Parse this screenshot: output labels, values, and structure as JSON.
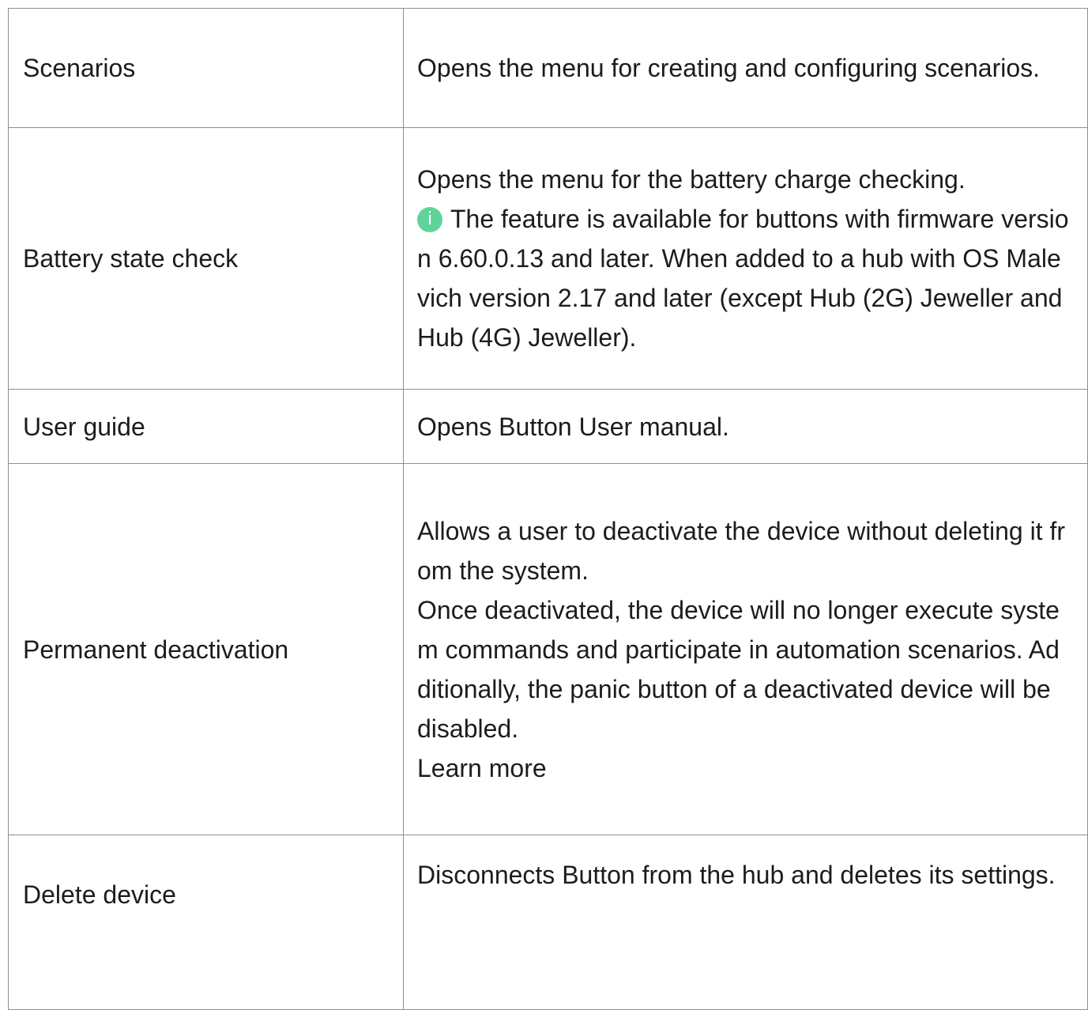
{
  "rows": [
    {
      "name": "Scenarios",
      "desc": [
        "Opens the menu for creating and configuring scenarios."
      ]
    },
    {
      "name": "Battery state check",
      "desc": [
        "Opens the menu for the battery charge checking.",
        "The feature is available for buttons with firmware version 6.60.0.13 and later. When added to a hub with OS Malevich version 2.17 and later (except Hub (2G) Jeweller and Hub (4G) Jeweller)."
      ],
      "info_icon_glyph": "i",
      "info_icon": "info-circle-icon",
      "info_icon_color": "#5fd49a"
    },
    {
      "name": "User guide",
      "desc": [
        "Opens Button User manual."
      ]
    },
    {
      "name": "Permanent deactivation",
      "desc": [
        "Allows a user to deactivate the device without deleting it from the system.",
        "Once deactivated, the device will no longer execute system commands and participate in automation scenarios. Additionally, the panic button of a deactivated device will be disabled.",
        "Learn more"
      ]
    },
    {
      "name": "Delete device",
      "desc": [
        "Disconnects Button from the hub and deletes its settings."
      ]
    }
  ]
}
